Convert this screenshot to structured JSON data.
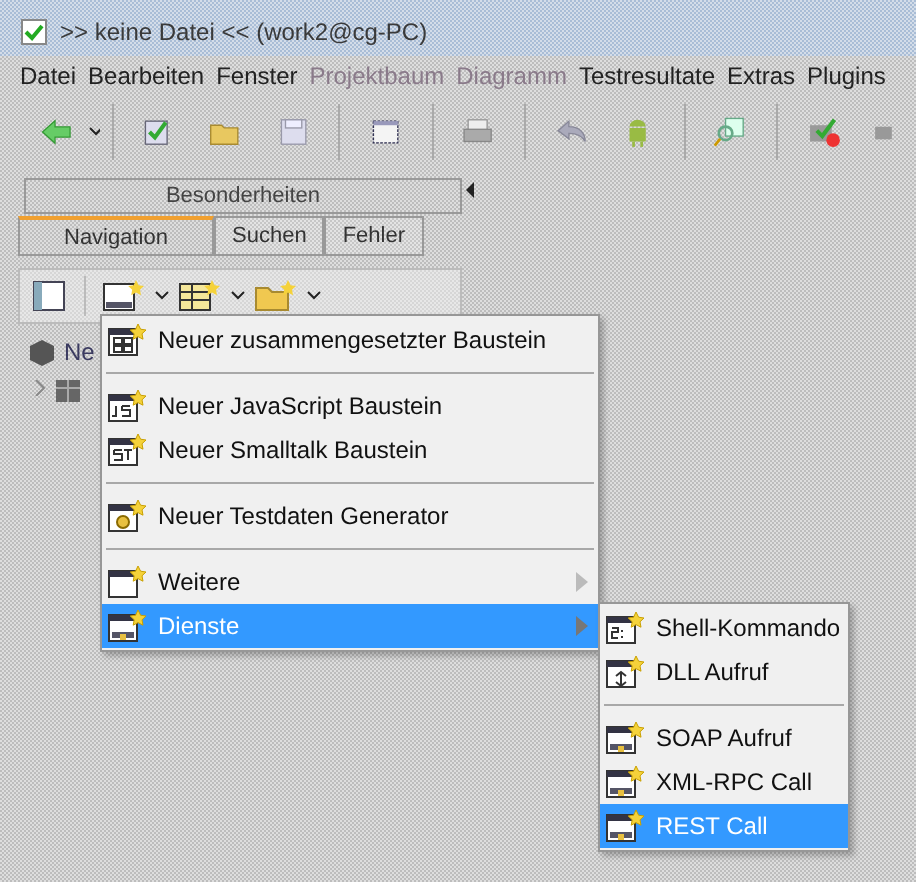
{
  "window": {
    "title": ">> keine Datei << (work2@cg-PC)"
  },
  "menu_bar": [
    {
      "label": "Datei",
      "disabled": false
    },
    {
      "label": "Bearbeiten",
      "disabled": false
    },
    {
      "label": "Fenster",
      "disabled": false
    },
    {
      "label": "Projektbaum",
      "disabled": true
    },
    {
      "label": "Diagramm",
      "disabled": true
    },
    {
      "label": "Testresultate",
      "disabled": false
    },
    {
      "label": "Extras",
      "disabled": false
    },
    {
      "label": "Plugins",
      "disabled": false
    }
  ],
  "side_panel": {
    "top_tab": "Besonderheiten",
    "tabs": [
      {
        "label": "Navigation",
        "selected": true
      },
      {
        "label": "Suchen",
        "selected": false
      },
      {
        "label": "Fehler",
        "selected": false
      }
    ],
    "tree": [
      {
        "label": "Ne"
      }
    ]
  },
  "context_menu": {
    "items": [
      {
        "kind": "item",
        "label": "Neuer zusammengesetzter Baustein",
        "selected": false,
        "submenu": false
      },
      {
        "kind": "separator"
      },
      {
        "kind": "item",
        "label": "Neuer JavaScript Baustein",
        "selected": false,
        "submenu": false
      },
      {
        "kind": "item",
        "label": "Neuer Smalltalk Baustein",
        "selected": false,
        "submenu": false
      },
      {
        "kind": "separator"
      },
      {
        "kind": "item",
        "label": "Neuer Testdaten Generator",
        "selected": false,
        "submenu": false
      },
      {
        "kind": "separator"
      },
      {
        "kind": "item",
        "label": "Weitere",
        "selected": false,
        "submenu": true
      },
      {
        "kind": "item",
        "label": "Dienste",
        "selected": true,
        "submenu": true
      }
    ]
  },
  "submenu": {
    "items": [
      {
        "kind": "item",
        "label": "Shell-Kommando",
        "selected": false,
        "submenu": false
      },
      {
        "kind": "item",
        "label": "DLL Aufruf",
        "selected": false,
        "submenu": false
      },
      {
        "kind": "separator"
      },
      {
        "kind": "item",
        "label": "SOAP Aufruf",
        "selected": false,
        "submenu": false
      },
      {
        "kind": "item",
        "label": "XML-RPC Call",
        "selected": false,
        "submenu": false
      },
      {
        "kind": "item",
        "label": "REST Call",
        "selected": true,
        "submenu": false
      }
    ]
  }
}
